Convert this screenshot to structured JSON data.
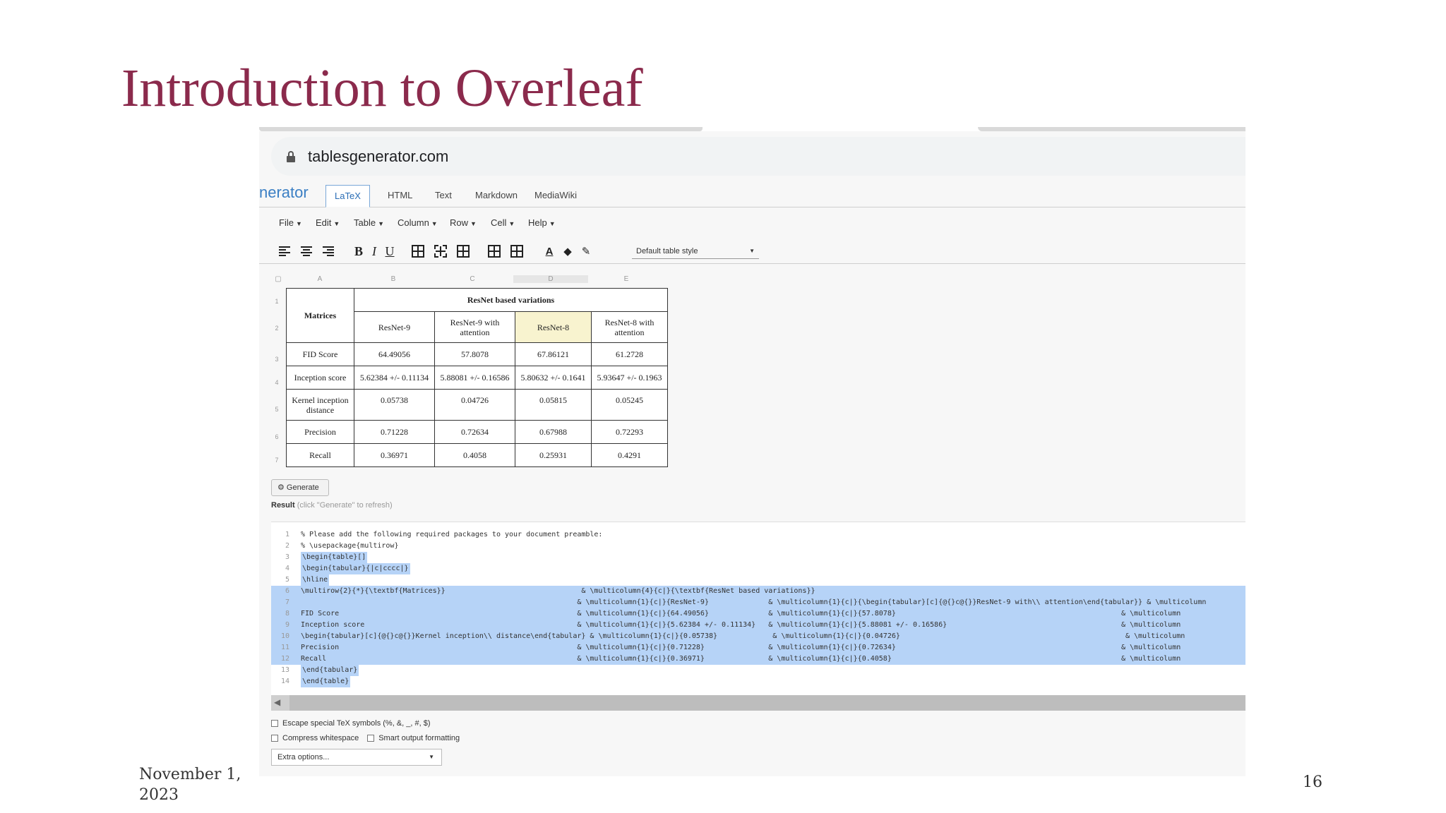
{
  "slide": {
    "title": "Introduction to Overleaf",
    "date": "November 1, 2023",
    "page_number": "16"
  },
  "browser": {
    "url": "tablesgenerator.com",
    "lock_icon": "lock-icon"
  },
  "app": {
    "brand_fragment": "nerator",
    "tabs": [
      "LaTeX",
      "HTML",
      "Text",
      "Markdown",
      "MediaWiki"
    ],
    "active_tab": "LaTeX",
    "menus": [
      "File",
      "Edit",
      "Table",
      "Column",
      "Row",
      "Cell",
      "Help"
    ],
    "table_style": "Default table style",
    "toolbar_icons": [
      "align-left-icon",
      "align-center-icon",
      "align-right-icon",
      "bold-icon",
      "italic-icon",
      "underline-icon",
      "all-borders-icon",
      "dashed-borders-icon",
      "clear-borders-icon",
      "merge-cells-icon",
      "split-cells-icon",
      "text-color-icon",
      "fill-color-icon",
      "clear-format-icon"
    ],
    "bold_label": "B",
    "italic_label": "I",
    "underline_label": "U"
  },
  "sheet": {
    "corner": "▢",
    "columns": [
      "A",
      "B",
      "C",
      "D",
      "E"
    ],
    "rows": [
      "1",
      "2",
      "3",
      "4",
      "5",
      "6",
      "7"
    ],
    "header_group": "ResNet based variations",
    "row_header": "Matrices",
    "variants": [
      "ResNet-9",
      "ResNet-9 with attention",
      "ResNet-8",
      "ResNet-8 with attention"
    ],
    "highlighted_col": "D",
    "data_rows": [
      {
        "label": "FID Score",
        "values": [
          "64.49056",
          "57.8078",
          "67.86121",
          "61.2728"
        ]
      },
      {
        "label": "Inception score",
        "values": [
          "5.62384 +/- 0.11134",
          "5.88081 +/- 0.16586",
          "5.80632 +/- 0.1641",
          "5.93647 +/- 0.1963"
        ]
      },
      {
        "label": "Kernel inception distance",
        "values": [
          "0.05738",
          "0.04726",
          "0.05815",
          "0.05245"
        ]
      },
      {
        "label": "Precision",
        "values": [
          "0.71228",
          "0.72634",
          "0.67988",
          "0.72293"
        ]
      },
      {
        "label": "Recall",
        "values": [
          "0.36971",
          "0.4058",
          "0.25931",
          "0.4291"
        ]
      }
    ]
  },
  "generate": {
    "button_label": "Generate",
    "result_label": "Result",
    "result_hint": "(click \"Generate\" to refresh)"
  },
  "code": [
    {
      "n": "1",
      "text": "% Please add the following required packages to your document preamble:",
      "hl": "none"
    },
    {
      "n": "2",
      "text": "% \\usepackage{multirow}",
      "hl": "none"
    },
    {
      "n": "3",
      "text": "\\begin{table}[]",
      "hl": "part"
    },
    {
      "n": "4",
      "text": "\\begin{tabular}{|c|cccc|}",
      "hl": "part"
    },
    {
      "n": "5",
      "text": "\\hline",
      "hl": "part"
    },
    {
      "n": "6",
      "text": "\\multirow{2}{*}{\\textbf{Matrices}}                                & \\multicolumn{4}{c|}{\\textbf{ResNet based variations}}",
      "hl": "full"
    },
    {
      "n": "7",
      "text": "                                                                 & \\multicolumn{1}{c|}{ResNet-9}              & \\multicolumn{1}{c|}{\\begin{tabular}[c]{@{}c@{}}ResNet-9 with\\\\ attention\\end{tabular}} & \\multicolumn",
      "hl": "full"
    },
    {
      "n": "8",
      "text": "FID Score                                                        & \\multicolumn{1}{c|}{64.49056}              & \\multicolumn{1}{c|}{57.8078}                                                     & \\multicolumn",
      "hl": "full"
    },
    {
      "n": "9",
      "text": "Inception score                                                  & \\multicolumn{1}{c|}{5.62384 +/- 0.11134}   & \\multicolumn{1}{c|}{5.88081 +/- 0.16586}                                         & \\multicolumn",
      "hl": "full"
    },
    {
      "n": "10",
      "text": "\\begin{tabular}[c]{@{}c@{}}Kernel inception\\\\ distance\\end{tabular} & \\multicolumn{1}{c|}{0.05738}             & \\multicolumn{1}{c|}{0.04726}                                                     & \\multicolumn",
      "hl": "full"
    },
    {
      "n": "11",
      "text": "Precision                                                        & \\multicolumn{1}{c|}{0.71228}               & \\multicolumn{1}{c|}{0.72634}                                                     & \\multicolumn",
      "hl": "full"
    },
    {
      "n": "12",
      "text": "Recall                                                           & \\multicolumn{1}{c|}{0.36971}               & \\multicolumn{1}{c|}{0.4058}                                                      & \\multicolumn",
      "hl": "full"
    },
    {
      "n": "13",
      "text": "\\end{tabular}",
      "hl": "part"
    },
    {
      "n": "14",
      "text": "\\end{table}",
      "hl": "part"
    }
  ],
  "options": {
    "escape_label": "Escape special TeX symbols (%, &, _, #, $)",
    "compress_label": "Compress whitespace",
    "smart_label": "Smart output formatting",
    "extra_label": "Extra options..."
  }
}
